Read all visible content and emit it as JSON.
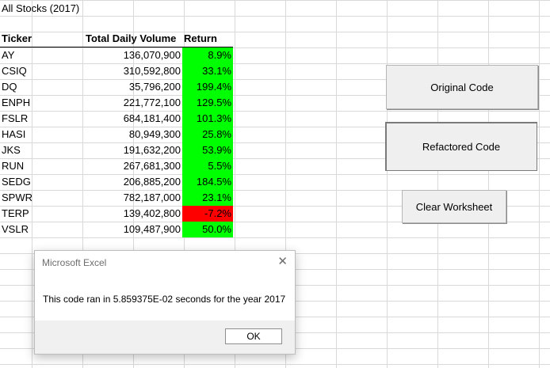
{
  "sheet": {
    "title": "All Stocks (2017)",
    "headers": [
      "Ticker",
      "Total Daily Volume",
      "Return"
    ],
    "rows": [
      {
        "ticker": "AY",
        "volume": "136,070,900",
        "return": "8.9%",
        "status": "positive"
      },
      {
        "ticker": "CSIQ",
        "volume": "310,592,800",
        "return": "33.1%",
        "status": "positive"
      },
      {
        "ticker": "DQ",
        "volume": "35,796,200",
        "return": "199.4%",
        "status": "positive"
      },
      {
        "ticker": "ENPH",
        "volume": "221,772,100",
        "return": "129.5%",
        "status": "positive"
      },
      {
        "ticker": "FSLR",
        "volume": "684,181,400",
        "return": "101.3%",
        "status": "positive"
      },
      {
        "ticker": "HASI",
        "volume": "80,949,300",
        "return": "25.8%",
        "status": "positive"
      },
      {
        "ticker": "JKS",
        "volume": "191,632,200",
        "return": "53.9%",
        "status": "positive"
      },
      {
        "ticker": "RUN",
        "volume": "267,681,300",
        "return": "5.5%",
        "status": "positive"
      },
      {
        "ticker": "SEDG",
        "volume": "206,885,200",
        "return": "184.5%",
        "status": "positive"
      },
      {
        "ticker": "SPWR",
        "volume": "782,187,000",
        "return": "23.1%",
        "status": "positive"
      },
      {
        "ticker": "TERP",
        "volume": "139,402,800",
        "return": "-7.2%",
        "status": "negative"
      },
      {
        "ticker": "VSLR",
        "volume": "109,487,900",
        "return": "50.0%",
        "status": "positive"
      }
    ]
  },
  "colors": {
    "positive_fill": "#00ff00",
    "negative_fill": "#ff0000",
    "gridline": "#d9d9d9"
  },
  "buttons": {
    "original": "Original Code",
    "refactored": "Refactored Code",
    "clear": "Clear Worksheet"
  },
  "dialog": {
    "title": "Microsoft Excel",
    "close_icon": "close-icon",
    "message": "This code ran in 5.859375E-02 seconds for the year 2017",
    "ok_label": "OK"
  }
}
